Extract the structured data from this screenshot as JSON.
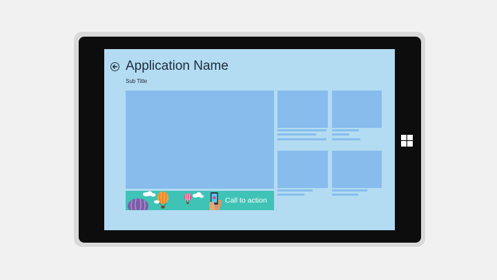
{
  "app": {
    "title": "Application Name",
    "subtitle": "Sub Title"
  },
  "banner": {
    "cta_label": "Call to action"
  },
  "colors": {
    "background": "#f1f1f1",
    "device_frame": "#d9d9d9",
    "bezel": "#0d0d0d",
    "screen": "#b3dcf2",
    "tile": "#87bcec",
    "banner": "#3fc3b6",
    "text": "#1e2b3a"
  },
  "icons": {
    "back": "back-arrow-icon",
    "windows": "windows-logo-icon"
  }
}
